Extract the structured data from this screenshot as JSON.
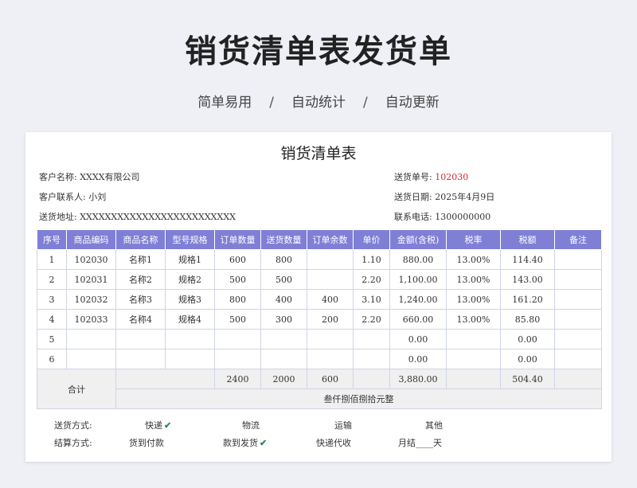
{
  "banner": {
    "title": "销货清单表发货单",
    "features": [
      "简单易用",
      "自动统计",
      "自动更新"
    ],
    "separator": "/"
  },
  "sheet": {
    "title": "销货清单表",
    "info": {
      "customer_name_label": "客户名称:",
      "customer_name": "XXXX有限公司",
      "contact_label": "客户联系人:",
      "contact": "小刘",
      "address_label": "送货地址:",
      "address": "XXXXXXXXXXXXXXXXXXXXXXXXX",
      "order_no_label": "送货单号:",
      "order_no": "102030",
      "date_label": "送货日期:",
      "date": "2025年4月9日",
      "phone_label": "联系电话:",
      "phone": "1300000000"
    },
    "table": {
      "columns": [
        "序号",
        "商品编码",
        "商品名称",
        "型号规格",
        "订单数量",
        "送货数量",
        "订单余数",
        "单价",
        "金额(含税)",
        "税率",
        "税额",
        "备注"
      ],
      "rows": [
        [
          "1",
          "102030",
          "名称1",
          "规格1",
          "600",
          "800",
          "",
          "1.10",
          "880.00",
          "13.00%",
          "114.40",
          ""
        ],
        [
          "2",
          "102031",
          "名称2",
          "规格2",
          "500",
          "500",
          "",
          "2.20",
          "1,100.00",
          "13.00%",
          "143.00",
          ""
        ],
        [
          "3",
          "102032",
          "名称3",
          "规格3",
          "800",
          "400",
          "400",
          "3.10",
          "1,240.00",
          "13.00%",
          "161.20",
          ""
        ],
        [
          "4",
          "102033",
          "名称4",
          "规格4",
          "500",
          "300",
          "200",
          "2.20",
          "660.00",
          "13.00%",
          "85.80",
          ""
        ],
        [
          "5",
          "",
          "",
          "",
          "",
          "",
          "",
          "",
          "0.00",
          "",
          "0.00",
          ""
        ],
        [
          "6",
          "",
          "",
          "",
          "",
          "",
          "",
          "",
          "0.00",
          "",
          "0.00",
          ""
        ]
      ],
      "total": {
        "label": "合计",
        "order_qty": "2400",
        "delivery_qty": "2000",
        "remaining": "600",
        "amount": "3,880.00",
        "tax": "504.40",
        "amount_in_words": "叁仟捌佰捌拾元整"
      }
    },
    "delivery_method": {
      "label": "送货方式:",
      "options": [
        {
          "text": "快递",
          "checked": true
        },
        {
          "text": "物流",
          "checked": false
        },
        {
          "text": "运输",
          "checked": false
        },
        {
          "text": "其他",
          "checked": false
        }
      ]
    },
    "settlement_method": {
      "label": "结算方式:",
      "options": [
        {
          "text": "货到付款",
          "checked": false
        },
        {
          "text": "款到发货",
          "checked": true
        },
        {
          "text": "快递代收",
          "checked": false
        },
        {
          "text": "月结____天",
          "checked": false
        }
      ]
    },
    "check_mark": "✔"
  }
}
